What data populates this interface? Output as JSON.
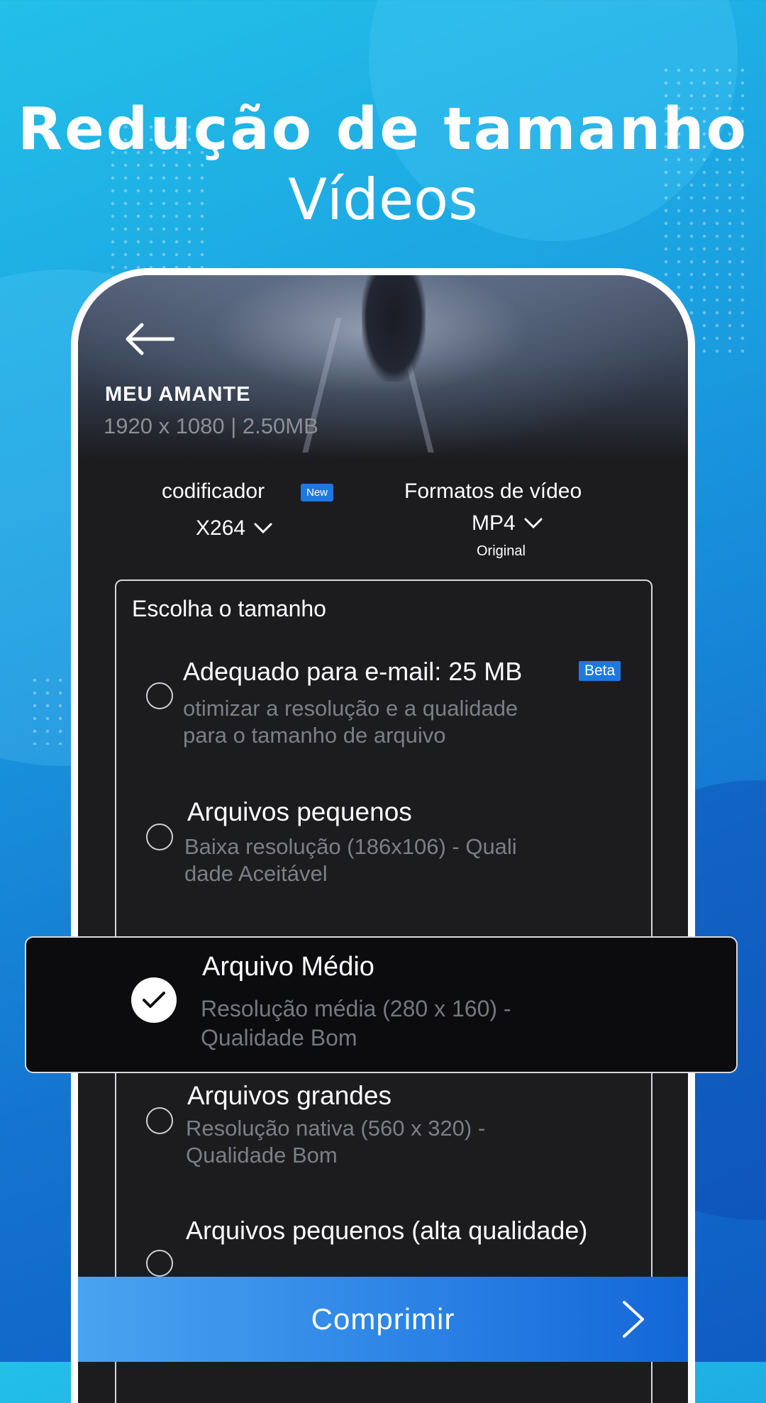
{
  "headline": {
    "line1": "Redução de tamanho",
    "line2": "Vídeos"
  },
  "video": {
    "title": "MEU AMANTE",
    "meta": "1920 x 1080 | 2.50MB"
  },
  "encoder": {
    "label": "codificador",
    "badge": "New",
    "value": "X264"
  },
  "format": {
    "label": "Formatos de vídeo",
    "value": "MP4",
    "sub": "Original"
  },
  "size_section": {
    "title": "Escolha o tamanho",
    "options": [
      {
        "title": "Adequado para e-mail: 25 MB",
        "badge": "Beta",
        "desc": "otimizar a resolução e a qualidade\npara o tamanho de arquivo",
        "selected": false
      },
      {
        "title": "Arquivos pequenos",
        "desc": "Baixa resolução (186x106) - Quali\ndade Aceitável",
        "selected": false
      },
      {
        "title": "Arquivo Médio",
        "desc": "Resolução média (280 x 160) -\nQualidade Bom",
        "selected": true
      },
      {
        "title": "Arquivos grandes",
        "desc": "Resolução nativa (560 x 320) -\nQualidade Bom",
        "selected": false
      },
      {
        "title": "Arquivos pequenos (alta qualidade)",
        "desc": "",
        "selected": false
      }
    ]
  },
  "compress_button": {
    "label": "Comprimir"
  },
  "colors": {
    "accent": "#1e78e0",
    "background_top": "#23c0e8",
    "background_bottom": "#0f5cc2",
    "screen": "#1c1c1f",
    "selected_card": "#0c0c0e"
  },
  "icons": {
    "back": "arrow-left-icon",
    "dropdown": "chevron-down-icon",
    "check": "check-icon",
    "next": "chevron-right-icon"
  }
}
